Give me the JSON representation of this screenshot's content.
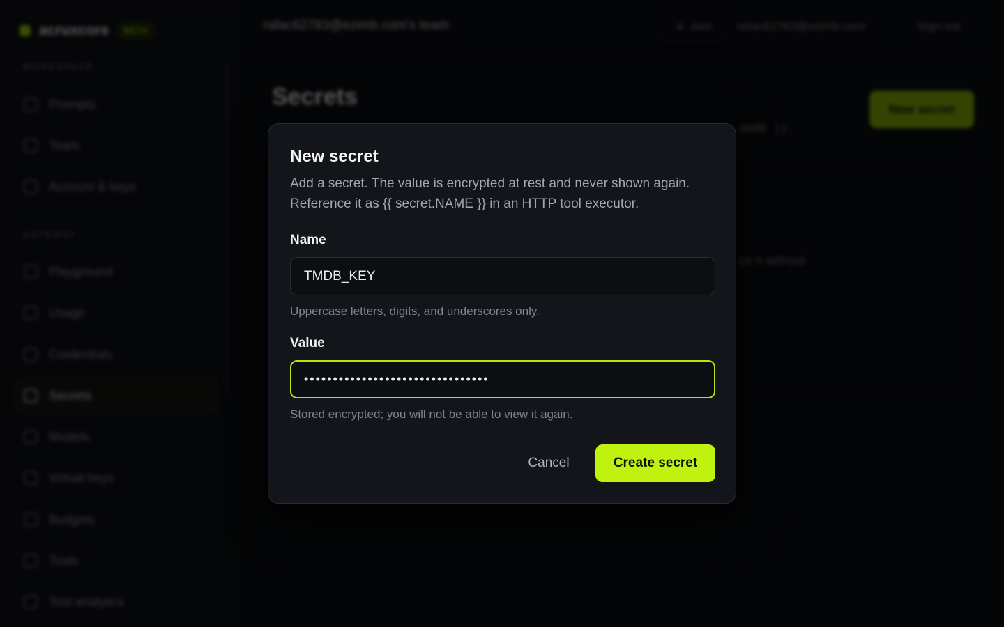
{
  "brand": {
    "name": "acruxcore",
    "badge": "BETA"
  },
  "sidebar": {
    "sections": [
      {
        "title": "WORKSPACE"
      },
      {
        "title": "GATEWAY"
      }
    ],
    "items": [
      {
        "label": "Prompts"
      },
      {
        "label": "Team"
      },
      {
        "label": "Account & keys"
      },
      {
        "label": "Playground"
      },
      {
        "label": "Usage"
      },
      {
        "label": "Credentials"
      },
      {
        "label": "Secrets"
      },
      {
        "label": "Models"
      },
      {
        "label": "Virtual keys"
      },
      {
        "label": "Budgets"
      },
      {
        "label": "Tools"
      },
      {
        "label": "Tool analytics"
      }
    ],
    "active": "Secrets"
  },
  "topbar": {
    "team": "rafac62783@ezimb.com's team",
    "theme_label": "dark",
    "user_email": "rafac62783@ezimb.com",
    "signout": "Sign out"
  },
  "page": {
    "title": "Secrets",
    "new_button": "New secret",
    "subtitle_fragment": "NAME }}.",
    "empty_fragment": "ce it without"
  },
  "dialog": {
    "title": "New secret",
    "description": "Add a secret. The value is encrypted at rest and never shown again. Reference it as {{ secret.NAME }} in an HTTP tool executor.",
    "name_label": "Name",
    "name_value": "TMDB_KEY",
    "name_help": "Uppercase letters, digits, and underscores only.",
    "value_label": "Value",
    "value_masked": "••••••••••••••••••••••••••••••••",
    "value_help": "Stored encrypted; you will not be able to view it again.",
    "cancel": "Cancel",
    "create": "Create secret"
  },
  "colors": {
    "accent": "#bff20f",
    "bg": "#07080a",
    "dialog": "#13151a"
  }
}
